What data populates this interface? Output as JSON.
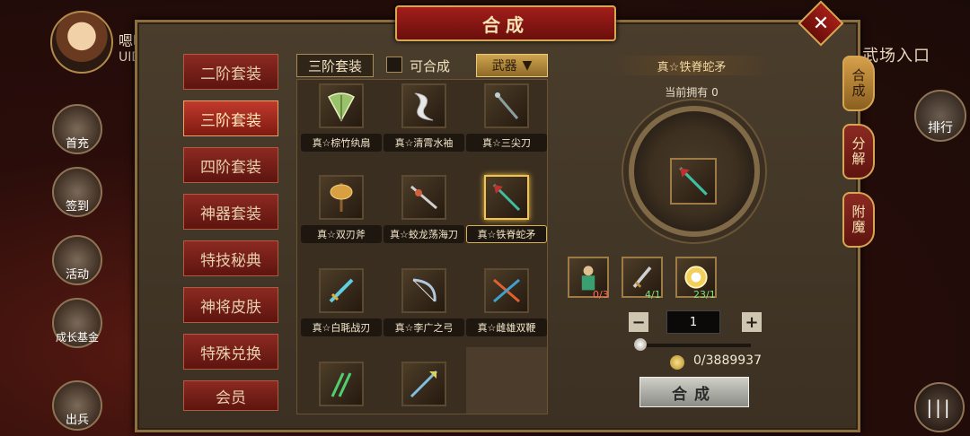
{
  "background": {
    "player_name": "嗯啊",
    "uid_label": "UID",
    "left_buttons": [
      "首充",
      "签到",
      "活动",
      "成长基金",
      "出兵"
    ],
    "right_sign": "武场入口",
    "rank_label": "排行",
    "menu_label": "|||"
  },
  "panel": {
    "title": "合成",
    "close_label": "✕"
  },
  "categories": [
    {
      "label": "二阶套装",
      "active": false
    },
    {
      "label": "三阶套装",
      "active": true
    },
    {
      "label": "四阶套装",
      "active": false
    },
    {
      "label": "神器套装",
      "active": false
    },
    {
      "label": "特技秘典",
      "active": false
    },
    {
      "label": "神将皮肤",
      "active": false
    },
    {
      "label": "特殊兑换",
      "active": false
    },
    {
      "label": "会员",
      "active": false
    }
  ],
  "filter": {
    "tier_label": "三阶套装",
    "craftable_label": "可合成",
    "type_label": "武器",
    "type_arrow": "▼"
  },
  "items": [
    {
      "name": "真☆棕竹纨扇",
      "icon": "fan-icon",
      "color": "#9ac26a"
    },
    {
      "name": "真☆清霄水袖",
      "icon": "sleeve-icon",
      "color": "#e8e8e8"
    },
    {
      "name": "真☆三尖刀",
      "icon": "trident-icon",
      "color": "#8aa0a0"
    },
    {
      "name": "真☆双刃斧",
      "icon": "axe-icon",
      "color": "#d8a040"
    },
    {
      "name": "真☆蛟龙荡海刀",
      "icon": "blade-icon",
      "color": "#d06040"
    },
    {
      "name": "真☆铁脊蛇矛",
      "icon": "spear-icon",
      "color": "#3fbfa0"
    },
    {
      "name": "真☆白毦战刃",
      "icon": "sword-icon",
      "color": "#5fcfe0"
    },
    {
      "name": "真☆李广之弓",
      "icon": "bow-icon",
      "color": "#b0c8e0"
    },
    {
      "name": "真☆雌雄双鞭",
      "icon": "whips-icon",
      "color": "#e06030"
    },
    {
      "name": "",
      "icon": "twin-blades-icon",
      "color": "#4fd070"
    },
    {
      "name": "",
      "icon": "halberd-icon",
      "color": "#7fc0e0"
    }
  ],
  "detail": {
    "title": "真☆铁脊蛇矛",
    "owned_label": "当前拥有 0",
    "materials": [
      {
        "icon": "warrior-icon",
        "count": "0/3",
        "count_color": "#ff6a5a"
      },
      {
        "icon": "sword-icon",
        "count": "4/1",
        "count_color": "#7ee07e"
      },
      {
        "icon": "gem-icon",
        "count": "23/1",
        "count_color": "#7ee07e"
      }
    ],
    "minus": "−",
    "plus": "+",
    "quantity": "1",
    "slider_fraction": 0,
    "cost": "0/3889937",
    "craft_label": "合成"
  },
  "side_tabs": [
    {
      "label": "合成",
      "active": true
    },
    {
      "label": "分解",
      "active": false
    },
    {
      "label": "附魔",
      "active": false
    }
  ]
}
